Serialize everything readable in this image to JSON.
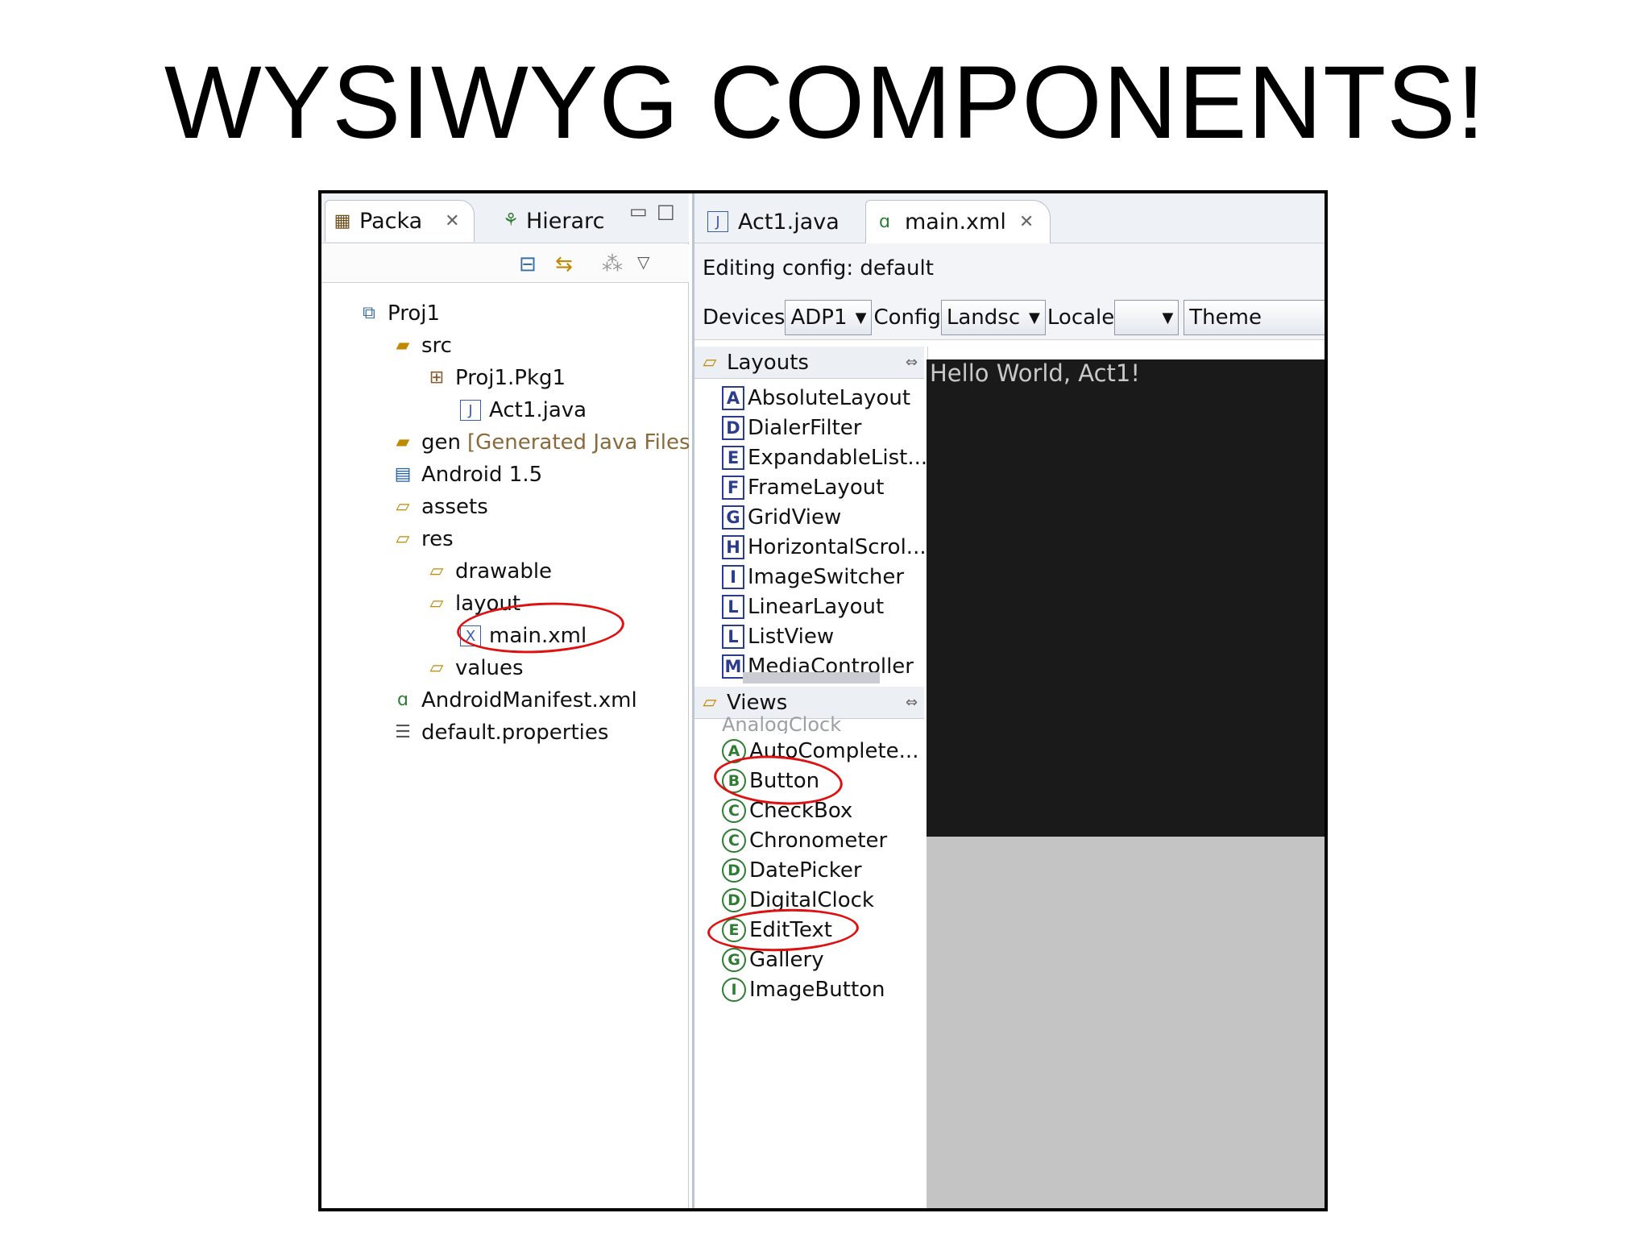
{
  "slide": {
    "title": "WYSIWYG COMPONENTS!"
  },
  "left_tabs": {
    "package": "Packa",
    "hierarchy": "Hierarc"
  },
  "tree": {
    "items": [
      {
        "label": "Proj1"
      },
      {
        "label": "src"
      },
      {
        "label": "Proj1.Pkg1"
      },
      {
        "label": "Act1.java"
      },
      {
        "label": "gen",
        "extra": "[Generated Java Files]"
      },
      {
        "label": "Android 1.5"
      },
      {
        "label": "assets"
      },
      {
        "label": "res"
      },
      {
        "label": "drawable"
      },
      {
        "label": "layout"
      },
      {
        "label": "main.xml"
      },
      {
        "label": "values"
      },
      {
        "label": "AndroidManifest.xml"
      },
      {
        "label": "default.properties"
      }
    ]
  },
  "editor_tabs": {
    "act1": "Act1.java",
    "main": "main.xml"
  },
  "config": {
    "editing": "Editing config:  default",
    "devices_label": "Devices",
    "devices_value": "ADP1",
    "config_label": "Config",
    "config_value": "Landsc",
    "locale_label": "Locale",
    "locale_value": "",
    "theme_value": "Theme"
  },
  "palette": {
    "layouts_title": "Layouts",
    "layouts": [
      {
        "letter": "A",
        "label": "AbsoluteLayout"
      },
      {
        "letter": "D",
        "label": "DialerFilter"
      },
      {
        "letter": "E",
        "label": "ExpandableList..."
      },
      {
        "letter": "F",
        "label": "FrameLayout"
      },
      {
        "letter": "G",
        "label": "GridView"
      },
      {
        "letter": "H",
        "label": "HorizontalScrol..."
      },
      {
        "letter": "I",
        "label": "ImageSwitcher"
      },
      {
        "letter": "L",
        "label": "LinearLayout"
      },
      {
        "letter": "L",
        "label": "ListView"
      },
      {
        "letter": "M",
        "label": "MediaController"
      }
    ],
    "views_title": "Views",
    "views_partial": "AnalogClock",
    "views": [
      {
        "letter": "A",
        "label": "AutoComplete..."
      },
      {
        "letter": "B",
        "label": "Button"
      },
      {
        "letter": "C",
        "label": "CheckBox"
      },
      {
        "letter": "C",
        "label": "Chronometer"
      },
      {
        "letter": "D",
        "label": "DatePicker"
      },
      {
        "letter": "D",
        "label": "DigitalClock"
      },
      {
        "letter": "E",
        "label": "EditText"
      },
      {
        "letter": "G",
        "label": "Gallery"
      },
      {
        "letter": "I",
        "label": "ImageButton"
      }
    ]
  },
  "canvas": {
    "text": "Hello World, Act1!"
  },
  "colors": {
    "highlight": "#e01010",
    "canvas_dark": "#1a1a1a",
    "canvas_gray": "#c4c4c4"
  }
}
